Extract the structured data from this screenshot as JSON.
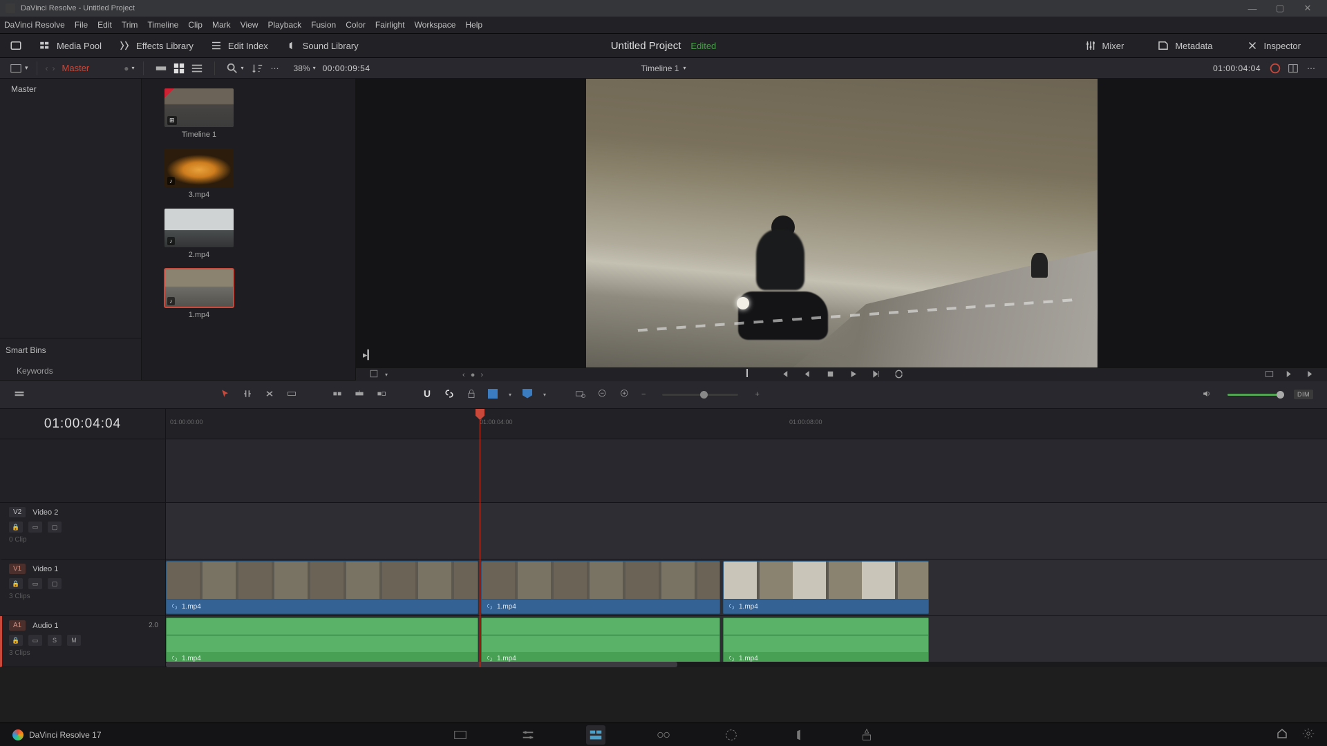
{
  "titlebar": {
    "app": "DaVinci Resolve",
    "doc": "Untitled Project"
  },
  "menu": [
    "DaVinci Resolve",
    "File",
    "Edit",
    "Trim",
    "Timeline",
    "Clip",
    "Mark",
    "View",
    "Playback",
    "Fusion",
    "Color",
    "Fairlight",
    "Workspace",
    "Help"
  ],
  "topbar": {
    "media": "Media Pool",
    "fx": "Effects Library",
    "idx": "Edit Index",
    "snd": "Sound Library",
    "proj": "Untitled Project",
    "status": "Edited",
    "mixer": "Mixer",
    "meta": "Metadata",
    "insp": "Inspector"
  },
  "toolbar": {
    "bin": "Master",
    "zoom": "38%",
    "tc": "00:00:09:54",
    "tl": "Timeline 1",
    "rtc": "01:00:04:04"
  },
  "bins": {
    "master": "Master",
    "smart": "Smart Bins",
    "kw": "Keywords"
  },
  "clips": [
    {
      "n": "Timeline 1",
      "cls": "t1",
      "b": "⊞"
    },
    {
      "n": "3.mp4",
      "cls": "t2",
      "b": "♪"
    },
    {
      "n": "2.mp4",
      "cls": "t3",
      "b": "♪"
    },
    {
      "n": "1.mp4",
      "cls": "t4",
      "b": "♪",
      "sel": true
    }
  ],
  "tl": {
    "tc": "01:00:04:04",
    "ruler": [
      "01:00:00:00",
      "01:00:04:00",
      "01:00:08:00"
    ],
    "v2": {
      "tag": "V2",
      "name": "Video 2",
      "cnt": "0 Clip"
    },
    "v1": {
      "tag": "V1",
      "name": "Video 1",
      "cnt": "3 Clips"
    },
    "a1": {
      "tag": "A1",
      "name": "Audio 1",
      "ch": "2.0",
      "cnt": "3 Clips"
    },
    "clip": "1.mp4"
  },
  "bottom": {
    "app": "DaVinci Resolve 17"
  },
  "dim": "DIM"
}
